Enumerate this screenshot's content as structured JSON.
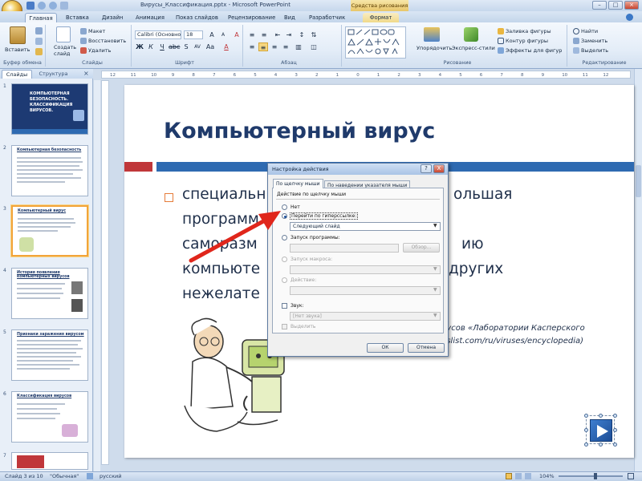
{
  "window": {
    "title": "Вирусы_Классификация.pptx - Microsoft PowerPoint",
    "contextual_tab_group": "Средства рисования"
  },
  "tabs": [
    "Главная",
    "Вставка",
    "Дизайн",
    "Анимация",
    "Показ слайдов",
    "Рецензирование",
    "Вид",
    "Разработчик",
    "Формат"
  ],
  "ribbon": {
    "clipboard": {
      "paste": "Вставить",
      "cut": "Вырезать",
      "copy": "Копировать",
      "format": "Формат",
      "label": "Буфер обмена"
    },
    "slides": {
      "new_slide": "Создать слайд",
      "layout": "Макет",
      "reset": "Восстановить",
      "delete": "Удалить",
      "label": "Слайды"
    },
    "font": {
      "name": "Calibri (Основной",
      "size": "18",
      "label": "Шрифт"
    },
    "paragraph": {
      "label": "Абзац"
    },
    "drawing": {
      "arrange": "Упорядочить",
      "quick_styles": "Экспресс-стили",
      "fill": "Заливка фигуры",
      "outline": "Контур фигуры",
      "effects": "Эффекты для фигур",
      "label": "Рисование"
    },
    "editing": {
      "find": "Найти",
      "replace": "Заменить",
      "select": "Выделить",
      "label": "Редактирование"
    }
  },
  "left_panel": {
    "tab_slides": "Слайды",
    "tab_outline": "Структура",
    "thumbs": [
      {
        "num": "1",
        "title": "КОМПЬЮТЕРНАЯ БЕЗОПАСНОСТЬ. КЛАССИФИКАЦИЯ ВИРУСОВ."
      },
      {
        "num": "2",
        "title": "Компьютерная безопасность"
      },
      {
        "num": "3",
        "title": "Компьютерный вирус"
      },
      {
        "num": "4",
        "title": "История появления компьютерных вирусов"
      },
      {
        "num": "5",
        "title": "Признаки заражения вирусом"
      },
      {
        "num": "6",
        "title": "Классификация вирусов"
      },
      {
        "num": "7",
        "title": ""
      }
    ]
  },
  "ruler_ticks": [
    "12",
    "11",
    "10",
    "9",
    "8",
    "7",
    "6",
    "5",
    "4",
    "3",
    "2",
    "1",
    "0",
    "1",
    "2",
    "3",
    "4",
    "5",
    "6",
    "7",
    "8",
    "9",
    "10",
    "11",
    "12"
  ],
  "slide": {
    "title": "Компьютерный вирус",
    "body_lines": [
      "специальн",
      "программ",
      "саморазм",
      "компьюте",
      "нежелате"
    ],
    "body_tails": [
      "ольшая",
      "ию",
      "других"
    ],
    "ref_line1": "русов «Лаборатории Касперского",
    "ref_line2": "uslist.com/ru/viruses/encyclopedia)"
  },
  "dialog": {
    "title": "Настройка действия",
    "help_btn": "?",
    "close_btn": "X",
    "tab_click": "По щелчку мыши",
    "tab_hover": "По наведении указателя мыши",
    "group_label": "Действие по щелчку мыши",
    "option_none": "Нет",
    "option_hyperlink": "Перейти по гиперссылке:",
    "hyperlink_value": "Следующий слайд",
    "option_program": "Запуск программы:",
    "browse": "Обзор...",
    "option_macro": "Запуск макроса:",
    "option_action": "Действие:",
    "sound_label": "Звук:",
    "sound_value": "[Нет звука]",
    "highlight_label": "Выделить",
    "ok": "ОК",
    "cancel": "Отмена"
  },
  "status": {
    "slide_info": "Слайд 3 из 10",
    "theme": "\"Обычная\"",
    "language": "русский",
    "zoom": "104%"
  },
  "colors": {
    "title": "#1f3a6b",
    "accent_red": "#c0373a",
    "accent_blue": "#2e6ab1",
    "arrow": "#e0261b"
  }
}
